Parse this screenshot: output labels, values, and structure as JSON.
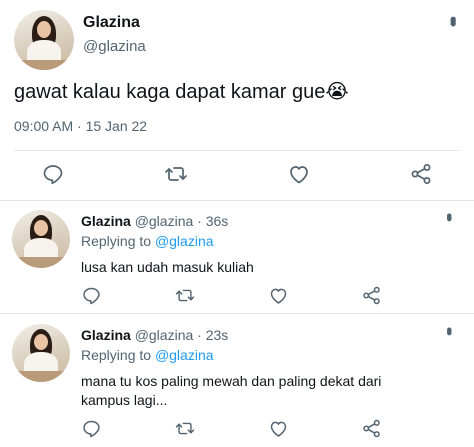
{
  "main_tweet": {
    "name": "Glazina",
    "handle": "@glazina",
    "text": "gawat kalau kaga dapat kamar gue😭",
    "timestamp": "09:00 AM · 15 Jan 22",
    "more_icon": "more-vertical-icon",
    "actions": [
      "reply-icon",
      "retweet-icon",
      "like-icon",
      "share-icon"
    ]
  },
  "replies": [
    {
      "name": "Glazina",
      "handle": "@glazina",
      "separator": "·",
      "time": "36s",
      "replying_prefix": "Replying to",
      "replying_handle": "@glazina",
      "text": "lusa kan udah masuk kuliah"
    },
    {
      "name": "Glazina",
      "handle": "@glazina",
      "separator": "·",
      "time": "23s",
      "replying_prefix": "Replying to",
      "replying_handle": "@glazina",
      "text": "mana tu kos paling mewah dan paling dekat dari kampus lagi..."
    }
  ],
  "colors": {
    "text": "#0f1419",
    "secondary": "#536471",
    "link": "#1d9bf0",
    "divider": "#e1e8ed"
  }
}
